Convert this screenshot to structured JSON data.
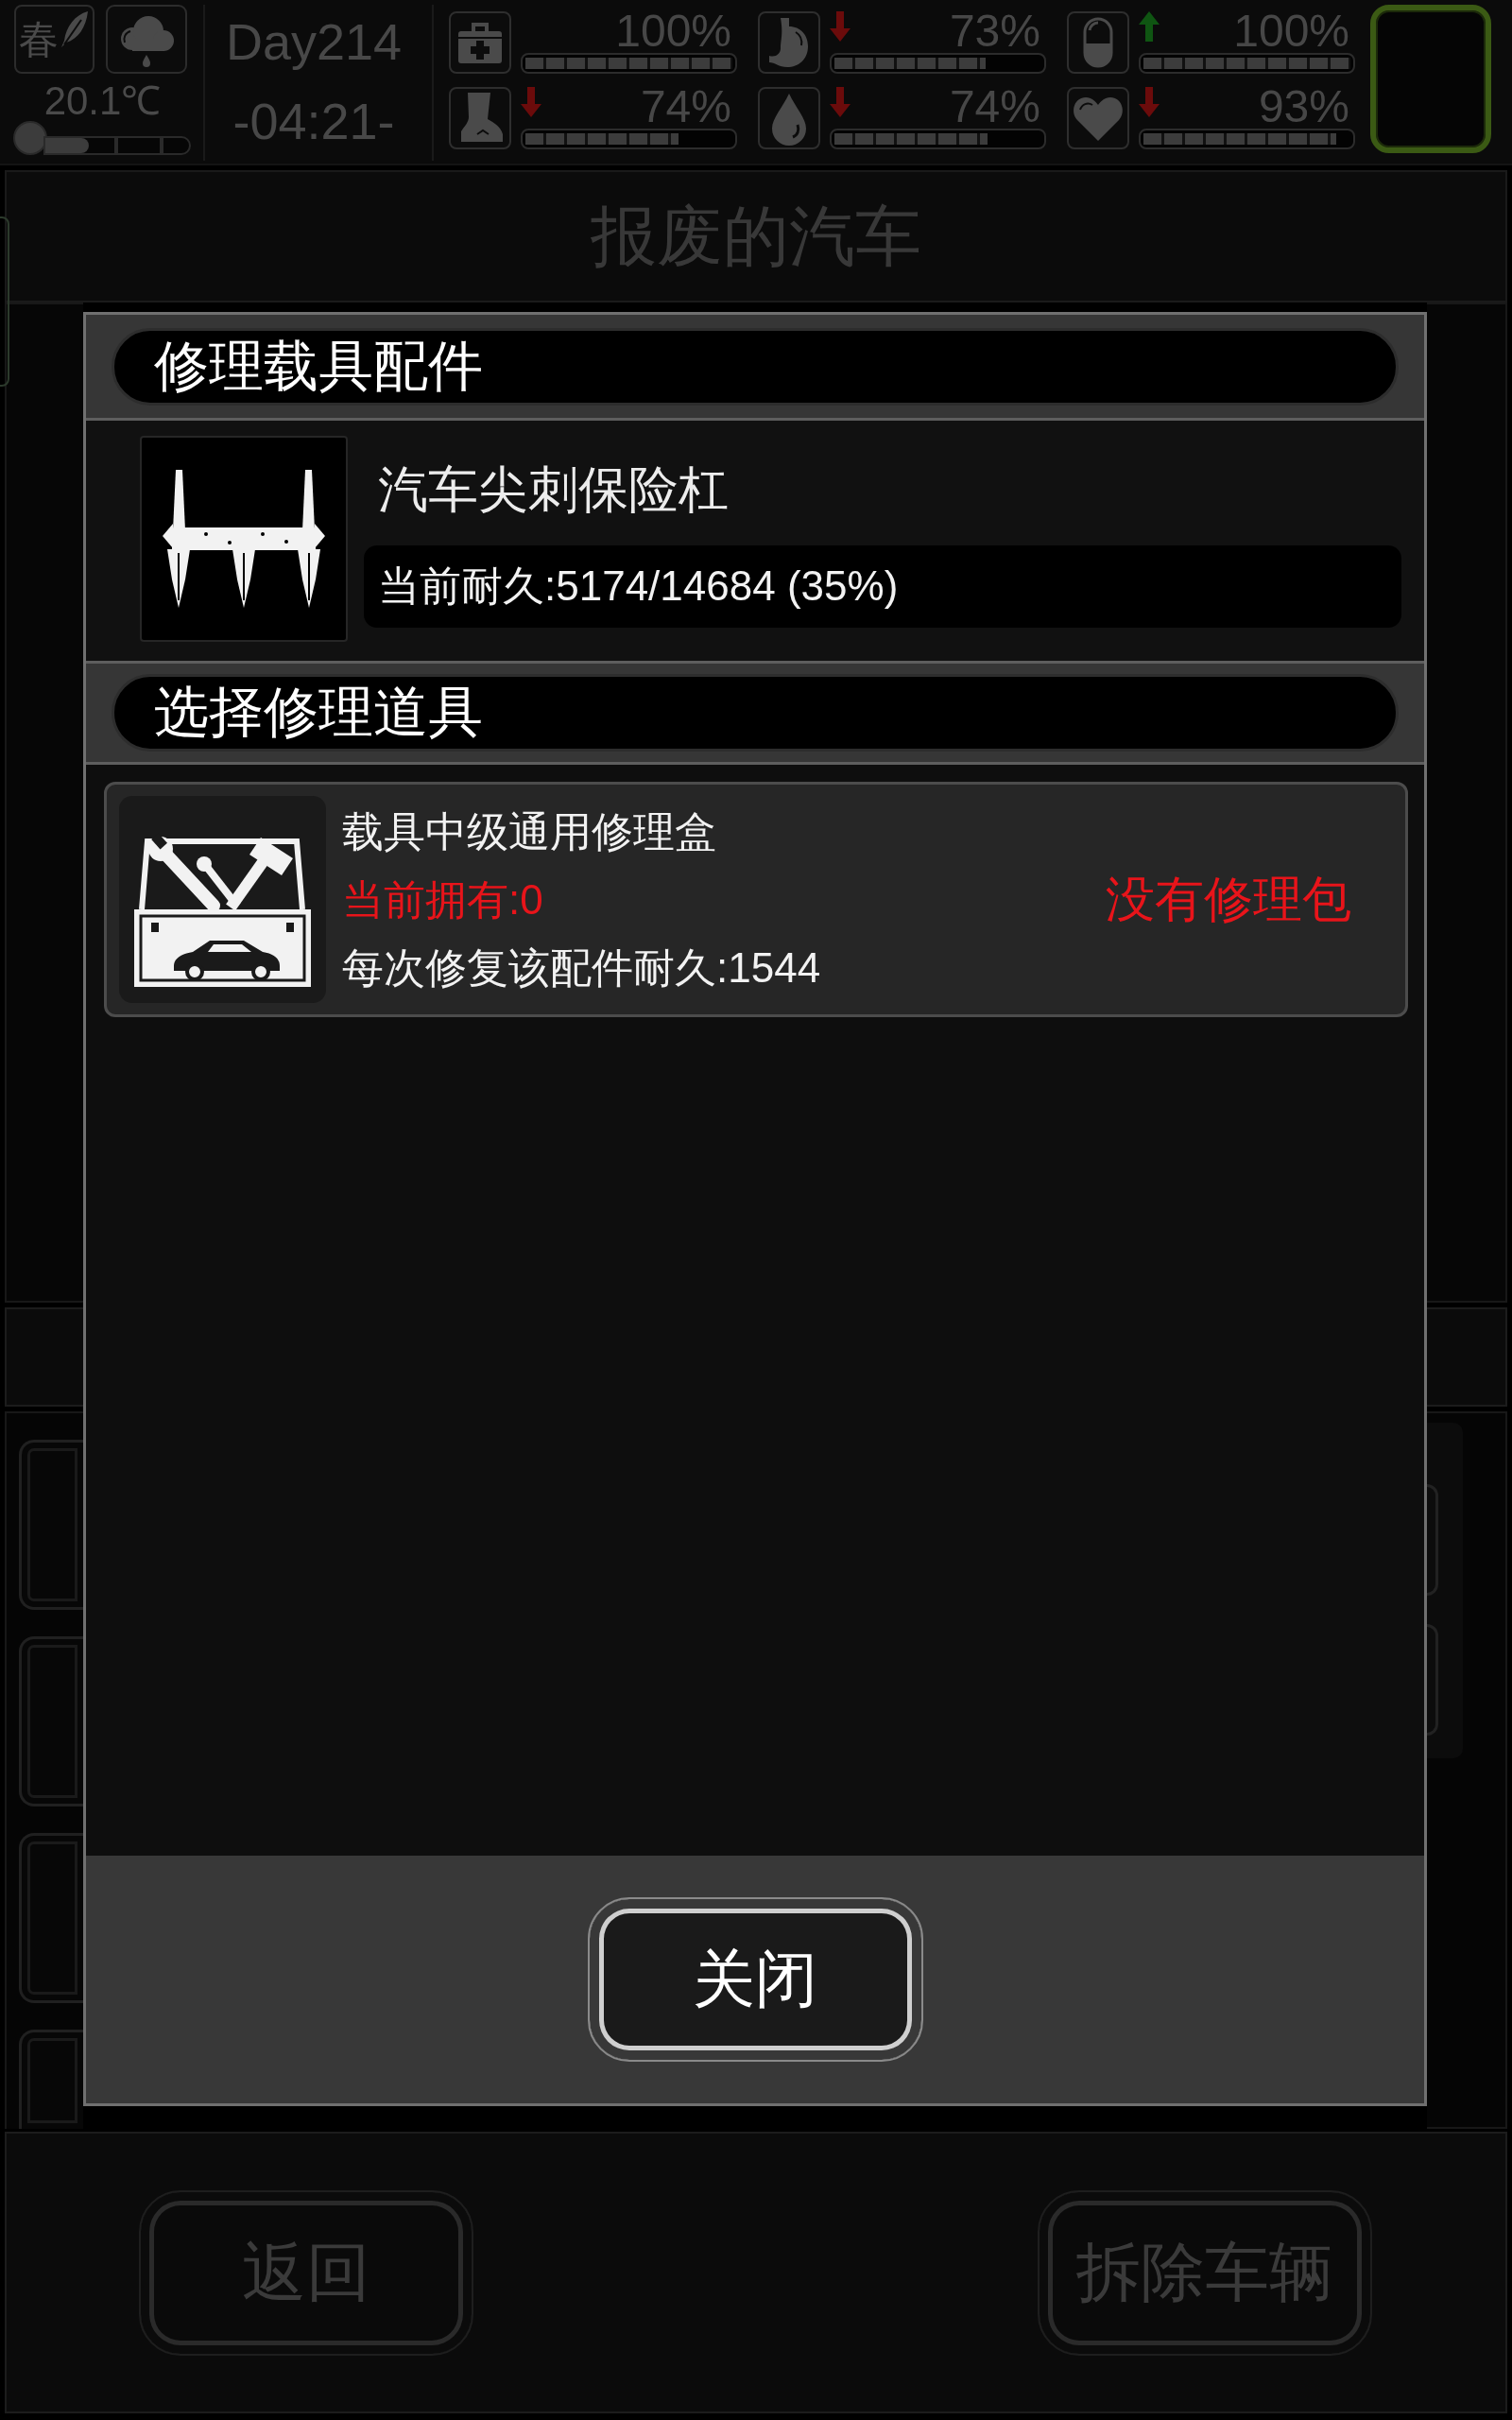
{
  "status_bar": {
    "season": "春",
    "temperature": "20.1℃",
    "thermometer": {
      "level": 0.3
    },
    "day": "Day214",
    "time": "-04:21-",
    "stats": [
      {
        "kind": "medkit",
        "rising": false,
        "falling": false,
        "value": "100%",
        "level": 1
      },
      {
        "kind": "stomach",
        "rising": false,
        "falling": true,
        "value": "73%",
        "level": 0.73
      },
      {
        "kind": "pill",
        "rising": true,
        "falling": false,
        "value": "100%",
        "level": 1
      },
      {
        "kind": "boot",
        "rising": false,
        "falling": true,
        "value": "74%",
        "level": 0.74
      },
      {
        "kind": "drop",
        "rising": false,
        "falling": true,
        "value": "74%",
        "level": 0.74
      },
      {
        "kind": "heart",
        "rising": false,
        "falling": true,
        "value": "93%",
        "level": 0.93
      }
    ]
  },
  "page_title": "报废的汽车",
  "dialog": {
    "part_header": "修理载具配件",
    "part": {
      "name": "汽车尖刺保险杠",
      "durability": "当前耐久:5174/14684 (35%)"
    },
    "tool_header": "选择修理道具",
    "tools": [
      {
        "name": "载具中级通用修理盒",
        "owned": "当前拥有:0",
        "available": false,
        "repair": "每次修复该配件耐久:1544",
        "status": "没有修理包"
      }
    ],
    "close_button": "关闭"
  },
  "bottom_buttons": [
    {
      "label": "返回"
    },
    {
      "label": "拆除车辆"
    }
  ]
}
